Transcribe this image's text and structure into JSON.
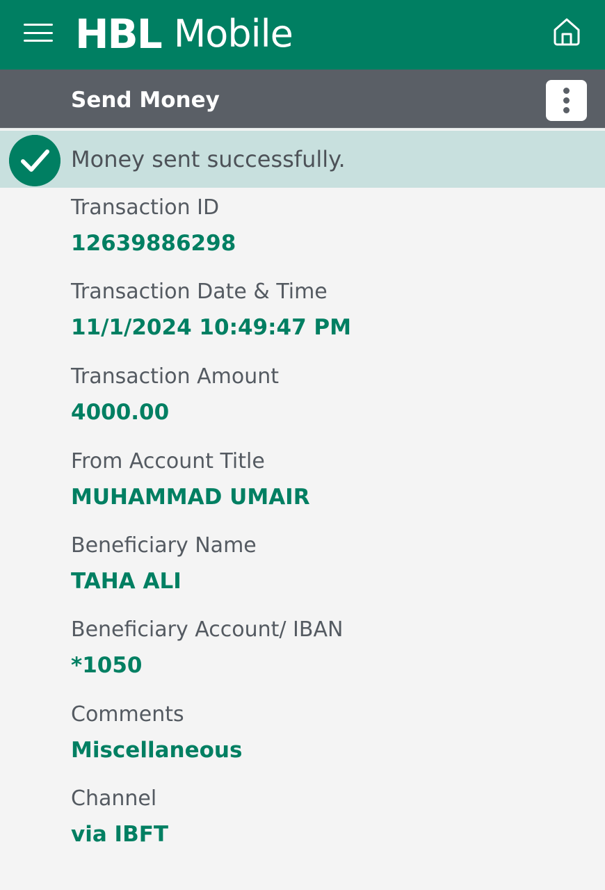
{
  "header": {
    "brand_mark": "HBL",
    "brand_name": "Mobile",
    "accent_color": "#007f62"
  },
  "subheader": {
    "title": "Send Money"
  },
  "banner": {
    "message": "Money sent successfully."
  },
  "details": [
    {
      "label": "Transaction ID",
      "value": "12639886298"
    },
    {
      "label": "Transaction Date & Time",
      "value": "11/1/2024 10:49:47 PM"
    },
    {
      "label": "Transaction Amount",
      "value": "4000.00"
    },
    {
      "label": "From Account Title",
      "value": "MUHAMMAD UMAIR"
    },
    {
      "label": "Beneficiary Name",
      "value": "TAHA ALI"
    },
    {
      "label": "Beneficiary Account/ IBAN",
      "value": "*1050"
    },
    {
      "label": "Comments",
      "value": "Miscellaneous"
    },
    {
      "label": "Channel",
      "value": "via IBFT"
    }
  ],
  "icons": {
    "menu": "hamburger-menu-icon",
    "home": "home-icon",
    "more": "more-vertical-icon",
    "success": "checkmark-icon"
  }
}
